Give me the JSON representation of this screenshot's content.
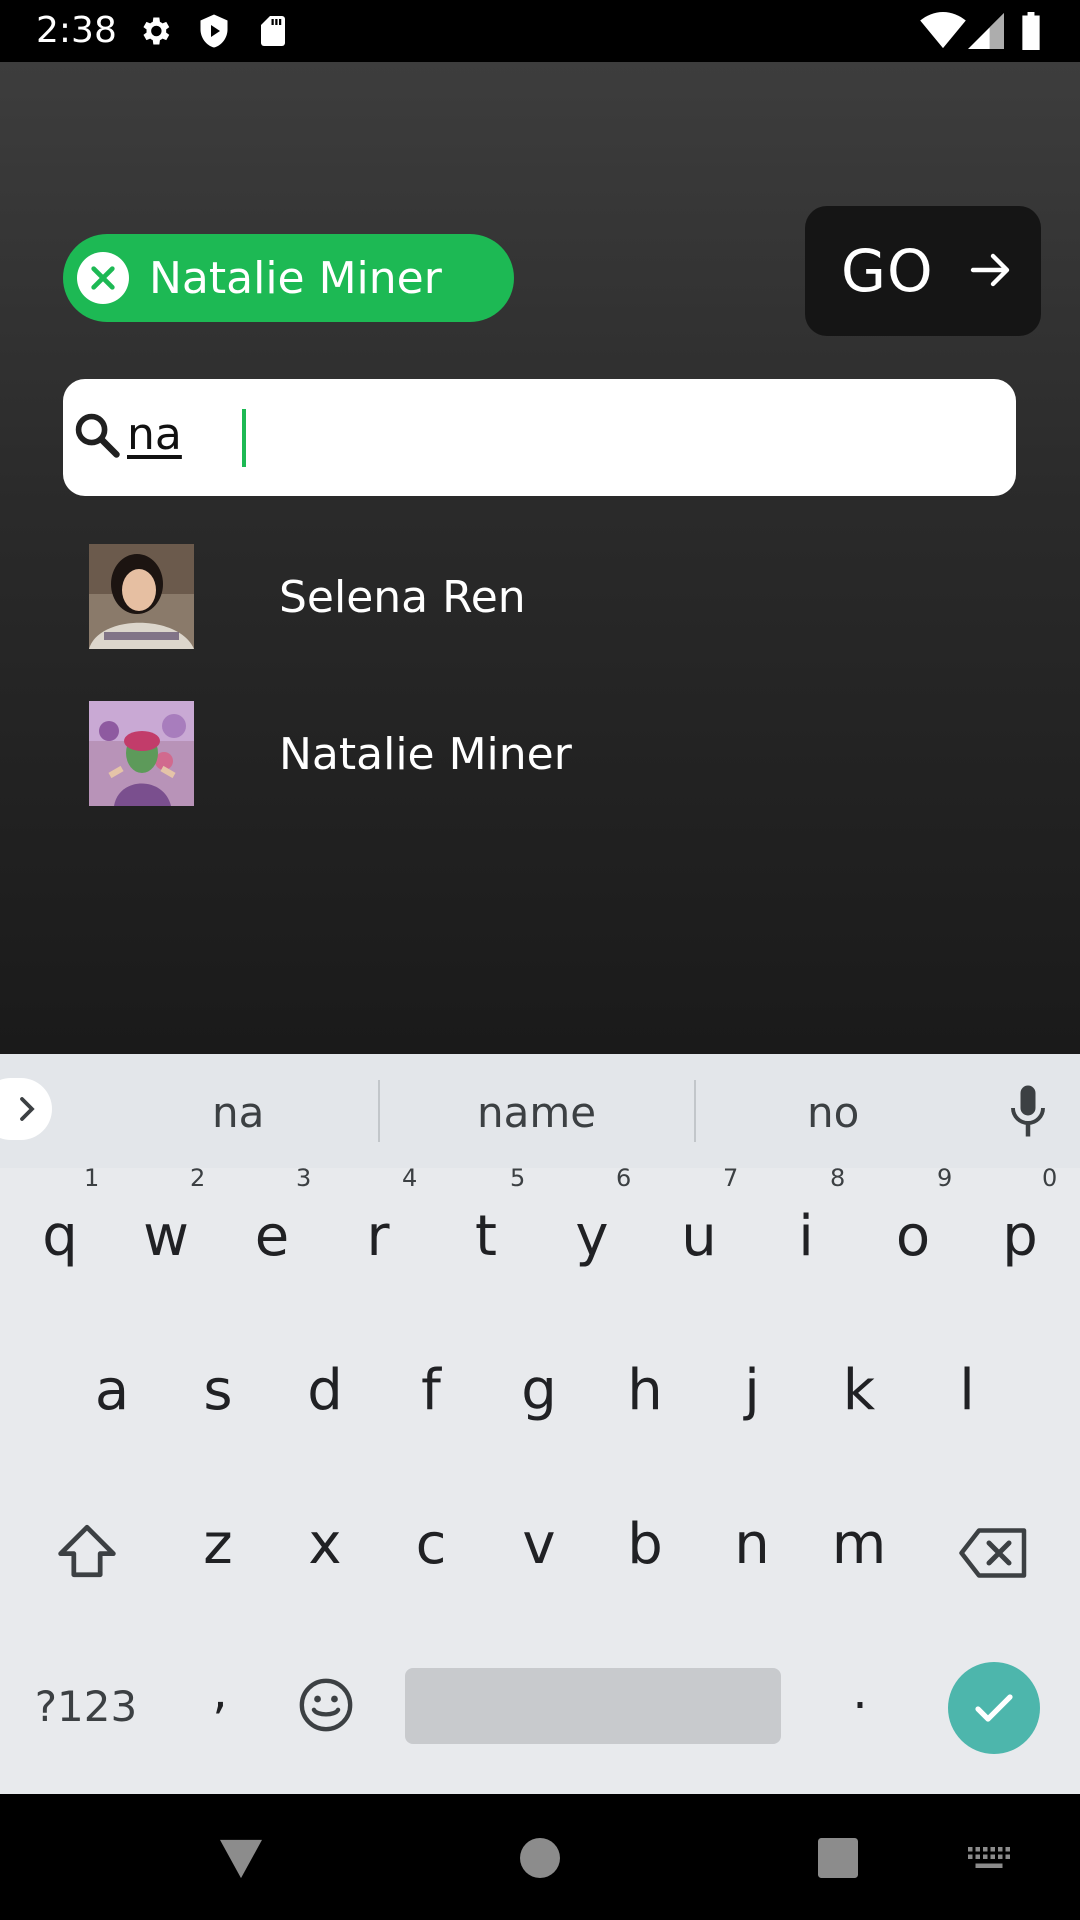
{
  "status_bar": {
    "time": "2:38",
    "icons": [
      "settings-icon",
      "shield-play-icon",
      "sd-card-icon",
      "wifi-icon",
      "signal-icon",
      "battery-icon"
    ]
  },
  "selected_chip": {
    "label": "Natalie Miner",
    "color": "#1db954"
  },
  "go_button": {
    "label": "GO"
  },
  "search": {
    "value": "na"
  },
  "results": [
    {
      "name": "Selena Ren"
    },
    {
      "name": "Natalie Miner"
    }
  ],
  "keyboard": {
    "suggestions": [
      "na",
      "name",
      "no"
    ],
    "row1": [
      {
        "key": "q",
        "hint": "1"
      },
      {
        "key": "w",
        "hint": "2"
      },
      {
        "key": "e",
        "hint": "3"
      },
      {
        "key": "r",
        "hint": "4"
      },
      {
        "key": "t",
        "hint": "5"
      },
      {
        "key": "y",
        "hint": "6"
      },
      {
        "key": "u",
        "hint": "7"
      },
      {
        "key": "i",
        "hint": "8"
      },
      {
        "key": "o",
        "hint": "9"
      },
      {
        "key": "p",
        "hint": "0"
      }
    ],
    "row2": [
      "a",
      "s",
      "d",
      "f",
      "g",
      "h",
      "j",
      "k",
      "l"
    ],
    "row3": [
      "z",
      "x",
      "c",
      "v",
      "b",
      "n",
      "m"
    ],
    "symbols_label": "?123",
    "comma": ",",
    "period": ".",
    "enter_color": "#4db6ac"
  }
}
